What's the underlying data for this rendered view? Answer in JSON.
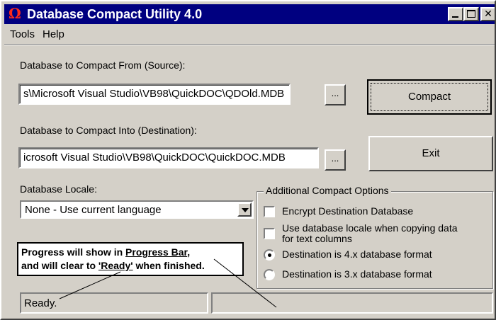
{
  "window": {
    "title": "Database Compact Utility 4.0",
    "app_icon": "omega-icon",
    "controls": [
      "minimize-icon",
      "maximize-icon",
      "close-icon"
    ]
  },
  "menu": {
    "tools": "Tools",
    "help": "Help"
  },
  "source": {
    "label": "Database to Compact From (Source):",
    "value": "s\\Microsoft Visual Studio\\VB98\\QuickDOC\\QDOld.MDB",
    "browse_label": "..."
  },
  "destination": {
    "label": "Database to Compact Into (Destination):",
    "value": "icrosoft Visual Studio\\VB98\\QuickDOC\\QuickDOC.MDB",
    "browse_label": "..."
  },
  "buttons": {
    "compact": "Compact",
    "exit": "Exit"
  },
  "locale": {
    "label": "Database Locale:",
    "selected": "None - Use current language"
  },
  "options": {
    "title": "Additional Compact Options",
    "encrypt": {
      "label": "Encrypt Destination Database",
      "checked": false
    },
    "use_locale": {
      "line1": "Use database locale when copying data",
      "line2": "for text columns",
      "checked": false
    },
    "format_4x": {
      "label": "Destination is 4.x database format",
      "selected": true
    },
    "format_3x": {
      "label": "Destination is 3.x database format",
      "selected": false
    }
  },
  "annotation": {
    "line1_prefix": "Progress will show in ",
    "line1_link": "Progress Bar",
    "line1_suffix": ",",
    "line2_prefix": "and will clear to ",
    "line2_link": "'Ready'",
    "line2_suffix": " when finished."
  },
  "status": {
    "text": "Ready.",
    "progress": ""
  },
  "colors": {
    "titlebar": "#000080",
    "face": "#d4d0c8",
    "icon": "#ff2a1a"
  }
}
